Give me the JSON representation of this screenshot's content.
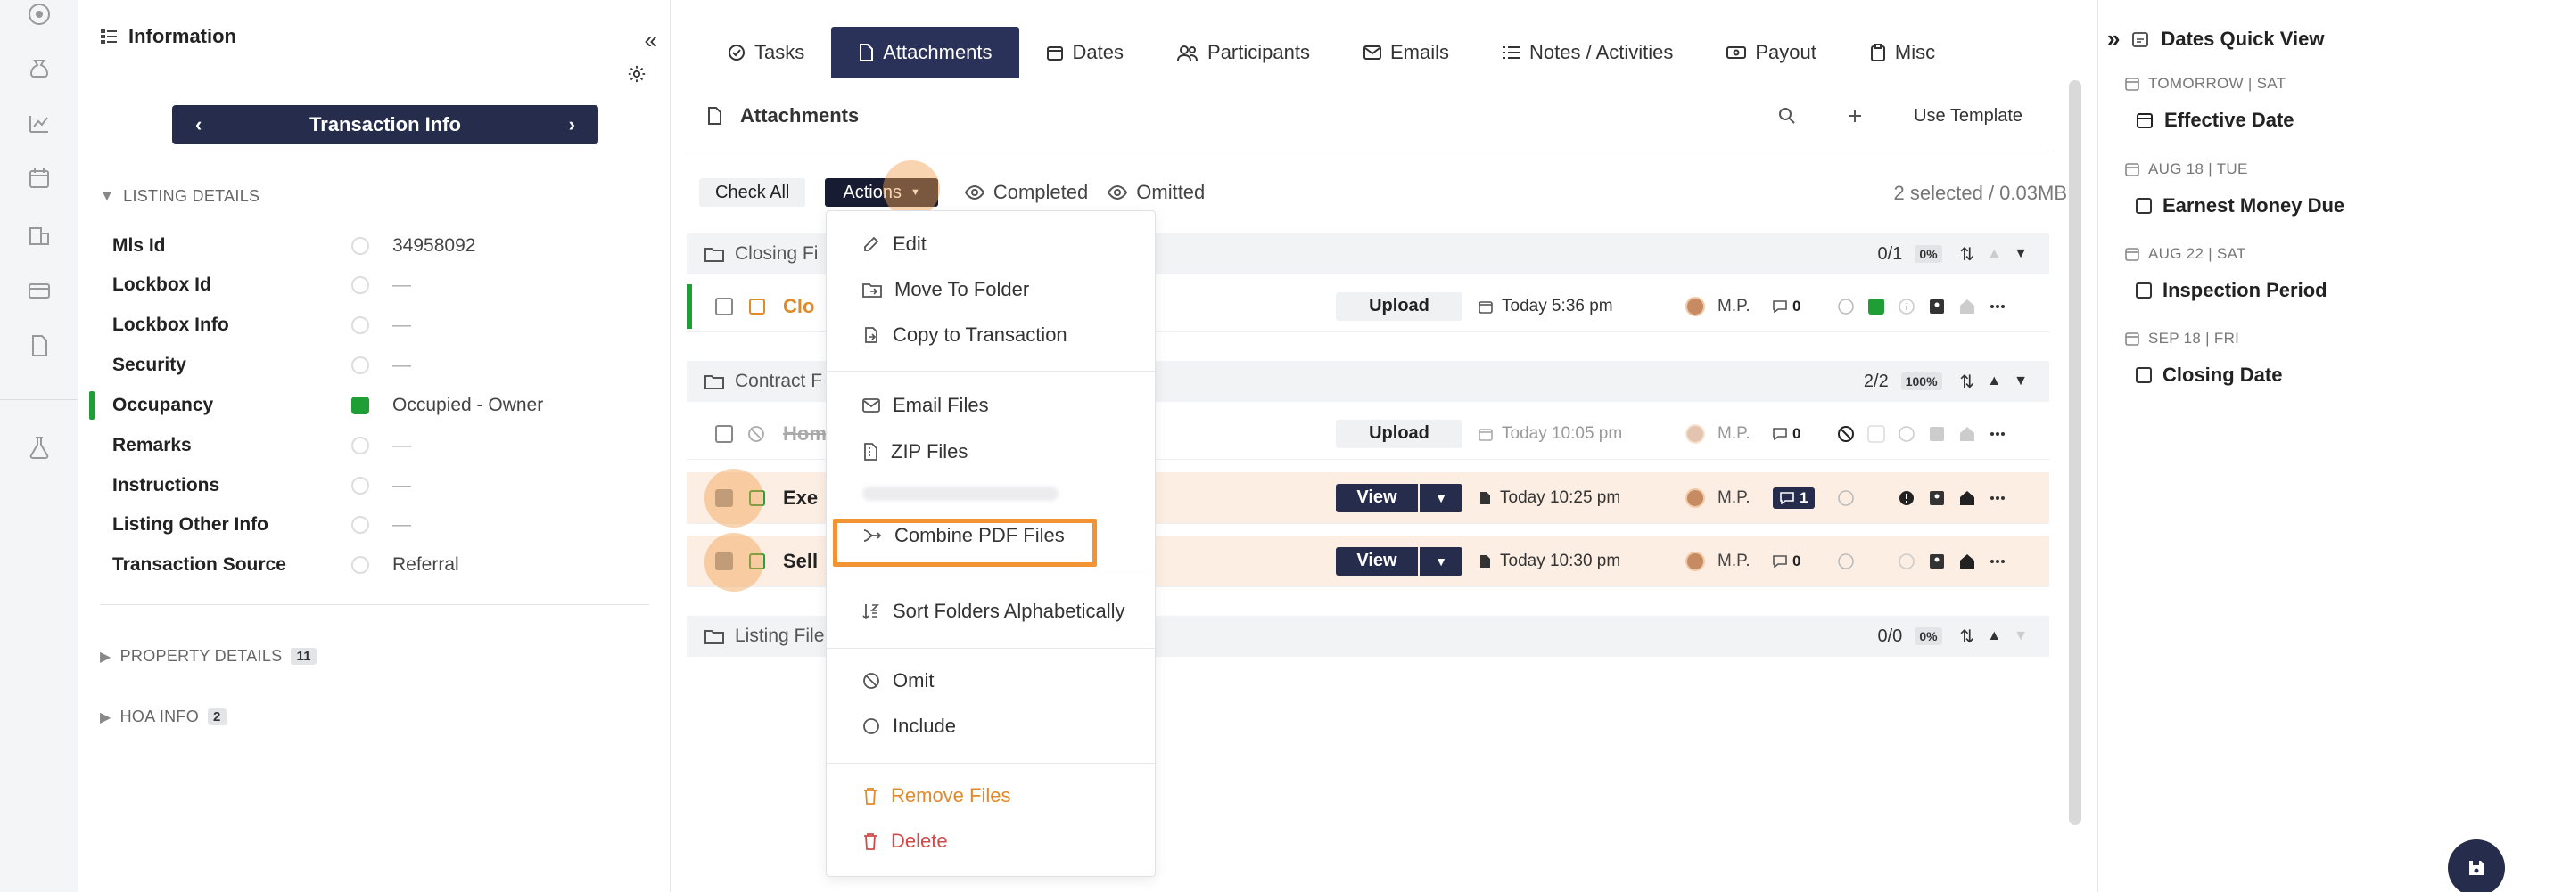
{
  "info_panel": {
    "title": "Information",
    "nav_button": "Transaction Info",
    "sections": {
      "listing": "LISTING DETAILS",
      "property": "PROPERTY DETAILS",
      "property_count": "11",
      "hoa": "HOA INFO",
      "hoa_count": "2"
    },
    "fields": [
      {
        "label": "Mls Id",
        "value": "34958092"
      },
      {
        "label": "Lockbox Id",
        "value": "—"
      },
      {
        "label": "Lockbox Info",
        "value": "—"
      },
      {
        "label": "Security",
        "value": "—"
      },
      {
        "label": "Occupancy",
        "value": "Occupied - Owner"
      },
      {
        "label": "Remarks",
        "value": "—"
      },
      {
        "label": "Instructions",
        "value": "—"
      },
      {
        "label": "Listing Other Info",
        "value": "—"
      },
      {
        "label": "Transaction Source",
        "value": "Referral"
      }
    ]
  },
  "tabs": [
    "Tasks",
    "Attachments",
    "Dates",
    "Participants",
    "Emails",
    "Notes / Activities",
    "Payout",
    "Misc"
  ],
  "attachments": {
    "title": "Attachments",
    "use_template": "Use Template",
    "check_all": "Check All",
    "actions": "Actions",
    "completed": "Completed",
    "omitted": "Omitted",
    "selection_info": "2 selected / 0.03MB",
    "folders": [
      {
        "name": "Closing Fi",
        "count": "0/1",
        "pct": "0%"
      },
      {
        "name": "Contract F",
        "count": "2/2",
        "pct": "100%"
      },
      {
        "name": "Listing File",
        "count": "0/0",
        "pct": "0%"
      }
    ],
    "files": [
      {
        "name": "Clo",
        "button": "Upload",
        "date": "Today 5:36 pm",
        "initials": "M.P.",
        "comments": "0"
      },
      {
        "name": "Hom",
        "button": "Upload",
        "date": "Today 10:05 pm",
        "initials": "M.P.",
        "comments": "0"
      },
      {
        "name": "Exe",
        "button": "View",
        "date": "Today 10:25 pm",
        "initials": "M.P.",
        "comments": "1"
      },
      {
        "name": "Sell",
        "button": "View",
        "date": "Today 10:30 pm",
        "initials": "M.P.",
        "comments": "0"
      }
    ]
  },
  "actions_menu": {
    "edit": "Edit",
    "move": "Move To Folder",
    "copy": "Copy to Transaction",
    "email": "Email Files",
    "zip": "ZIP Files",
    "combine": "Combine PDF Files",
    "sort": "Sort Folders Alphabetically",
    "omit": "Omit",
    "include": "Include",
    "remove": "Remove Files",
    "delete": "Delete"
  },
  "dates_panel": {
    "title": "Dates Quick View",
    "items": [
      {
        "when": "TOMORROW | SAT",
        "label": "Effective Date"
      },
      {
        "when": "AUG 18 | TUE",
        "label": "Earnest Money Due"
      },
      {
        "when": "AUG 22 | SAT",
        "label": "Inspection Period"
      },
      {
        "when": "SEP 18 | FRI",
        "label": "Closing Date"
      }
    ]
  },
  "colors": {
    "navy": "#262c4b",
    "accent_orange": "#f29334",
    "green": "#1e9e35",
    "danger": "#d24b4b"
  }
}
